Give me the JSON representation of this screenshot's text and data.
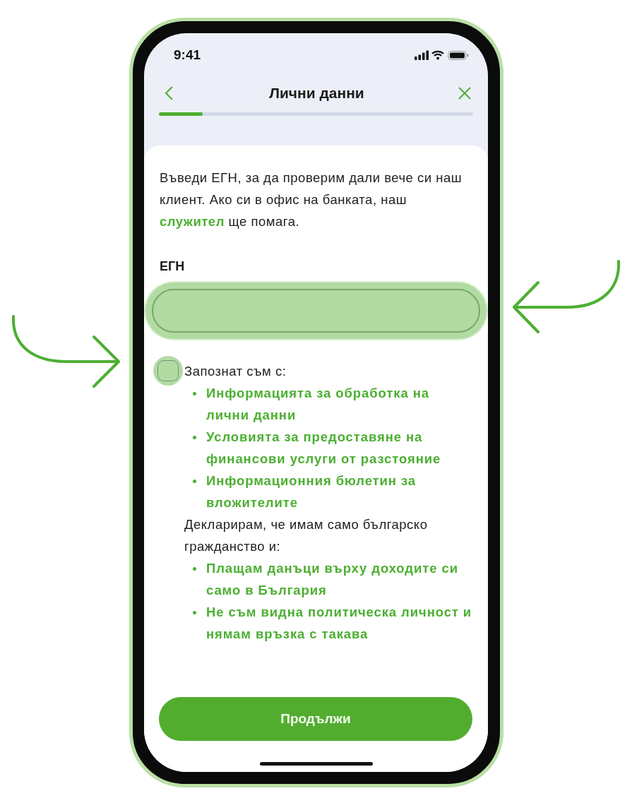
{
  "status_bar": {
    "time": "9:41"
  },
  "header": {
    "title": "Лични данни",
    "progress": {
      "level": 0.14
    }
  },
  "intro": "Въведи ЕГН, за да проверим дали вече си наш клиент. Ако си в офис на банката, наш **служител** ще помага.",
  "egn_field": {
    "label": "ЕГН",
    "highlighted": true
  },
  "consent": {
    "checked": false,
    "highlighted": true,
    "lead": "Запознат съм с:",
    "links": [
      "Информацията за обработка на лични данни",
      "Условията за предоставяне на финансови услуги от разстояние",
      "Информационния бюлетин за вложителите"
    ],
    "declaration": "Декларирам, че имам само българско гражданство и:",
    "declarations": [
      "Плащам данъци върху доходите си само в България",
      "Не съм видна политическа личност и нямам връзка с такава"
    ]
  },
  "primary_button": {
    "label": "Продължи"
  }
}
